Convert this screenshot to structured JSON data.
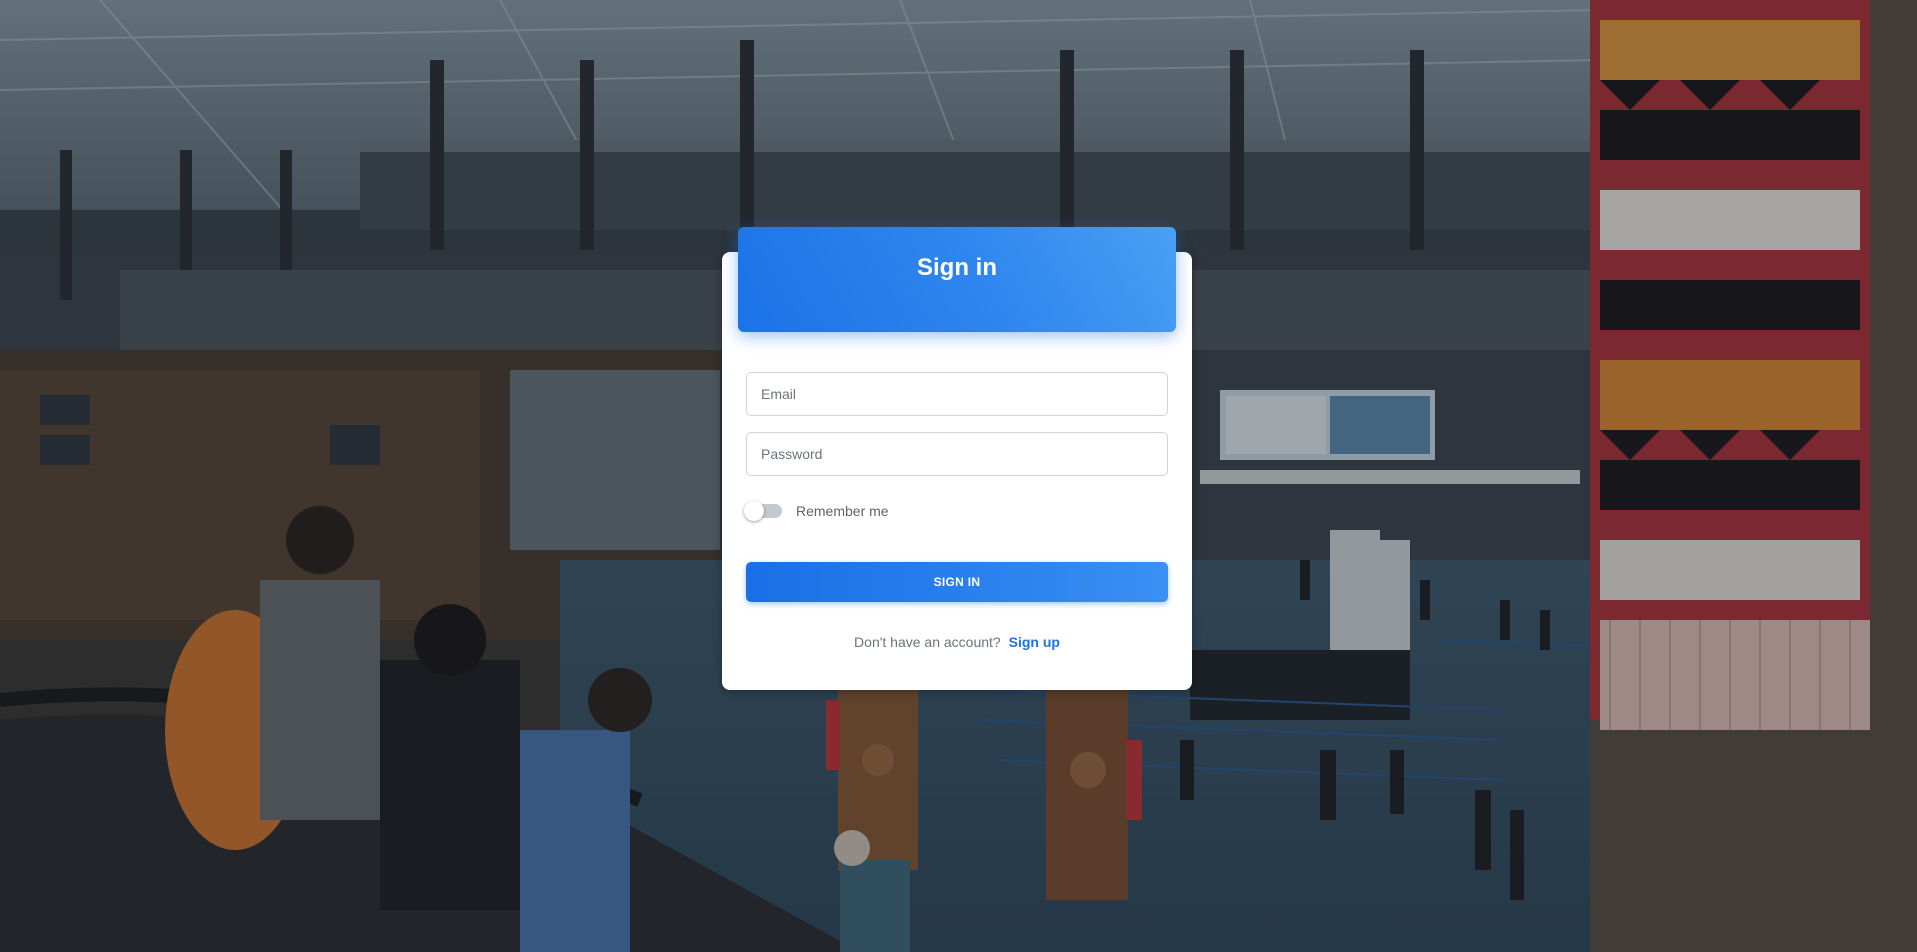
{
  "background": {
    "description_icon": "airport-terminal-photo-icon"
  },
  "form": {
    "title": "Sign in",
    "email_placeholder": "Email",
    "email_value": "",
    "password_placeholder": "Password",
    "password_value": "",
    "remember_label": "Remember me",
    "remember_checked": false,
    "submit_label": "SIGN IN",
    "signup_prompt": "Don't have an account?",
    "signup_link": "Sign up"
  },
  "colors": {
    "accent": "#1a73e8",
    "header_gradient_end": "#49a0f3",
    "toggle_off": "#c4c9cf"
  }
}
